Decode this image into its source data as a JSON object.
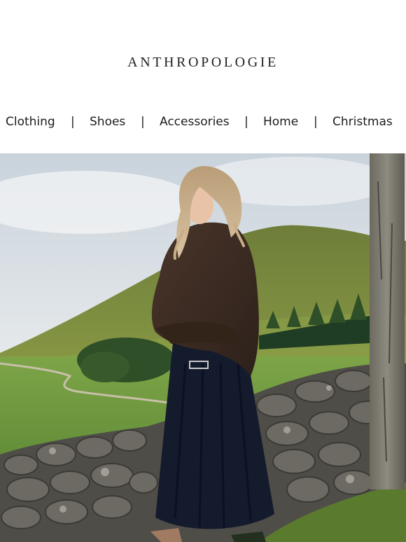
{
  "header": {
    "logo_text": "ANTHROPOLOGIE"
  },
  "nav": {
    "items": [
      {
        "label": "Clothing"
      },
      {
        "label": "Shoes"
      },
      {
        "label": "Accessories"
      },
      {
        "label": "Home"
      },
      {
        "label": "Christmas"
      }
    ],
    "separator": "|"
  },
  "hero": {
    "image_subject": "woman-in-brown-sweater-and-navy-skirt-by-stone-wall",
    "colors": {
      "sky": "#d9e0e6",
      "hill": "#6f7f3c",
      "field": "#5f8d3a",
      "sweater": "#3a2a22",
      "skirt": "#111a2b",
      "stone": "#5c5a55"
    }
  }
}
